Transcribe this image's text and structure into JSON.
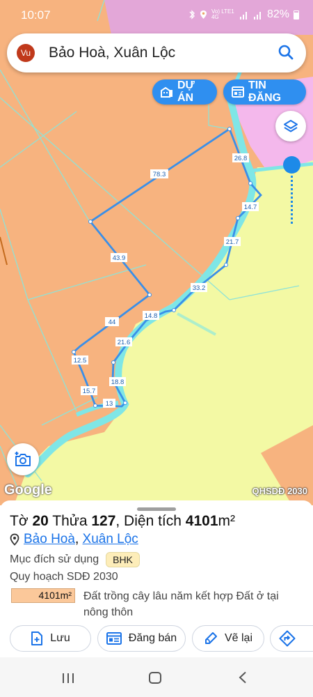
{
  "status_bar": {
    "time": "10:07",
    "network": "Vo) LTE1 4G",
    "battery": "82%"
  },
  "search": {
    "avatar_initials": "Vu",
    "query": "Bảo Hoà, Xuân Lộc"
  },
  "map_buttons": {
    "du_an": "DỰ ÁN",
    "tin_dang": "TIN ĐĂNG"
  },
  "map": {
    "google_logo": "Google",
    "layer_label": "QHSDĐ 2030",
    "colors": {
      "land_orange": "#f7b37f",
      "land_yellow": "#f3f9a4",
      "land_pink": "#f4b8ec",
      "stream_cyan": "#7fe6e6",
      "boundary_blue": "#3a8fe8",
      "accent_blue": "#2f8ff0"
    },
    "edge_labels": [
      "78.3",
      "26.8",
      "14.7",
      "21.7",
      "33.2",
      "14.8",
      "43.9",
      "44",
      "21.6",
      "12.5",
      "18.8",
      "15.7",
      "13"
    ]
  },
  "panel": {
    "title_prefix": "Tờ ",
    "sheet": "20",
    "title_mid": " Thửa ",
    "parcel": "127",
    "title_area_label": ", Diện tích ",
    "area_value": "4101",
    "area_unit": "m²",
    "location_commune": "Bảo Hoà",
    "location_separator": ",",
    "location_district": "Xuân Lộc",
    "purpose_label": "Mục đích sử dụng",
    "purpose_code": "BHK",
    "plan_label": "Quy hoạch SDĐ 2030",
    "plan_area": "4101m²",
    "plan_description": "Đất trồng cây lâu năm kết hợp Đất ở tại nông thôn"
  },
  "actions": {
    "save": "Lưu",
    "post_sale": "Đăng bán",
    "redraw": "Vẽ lại"
  }
}
